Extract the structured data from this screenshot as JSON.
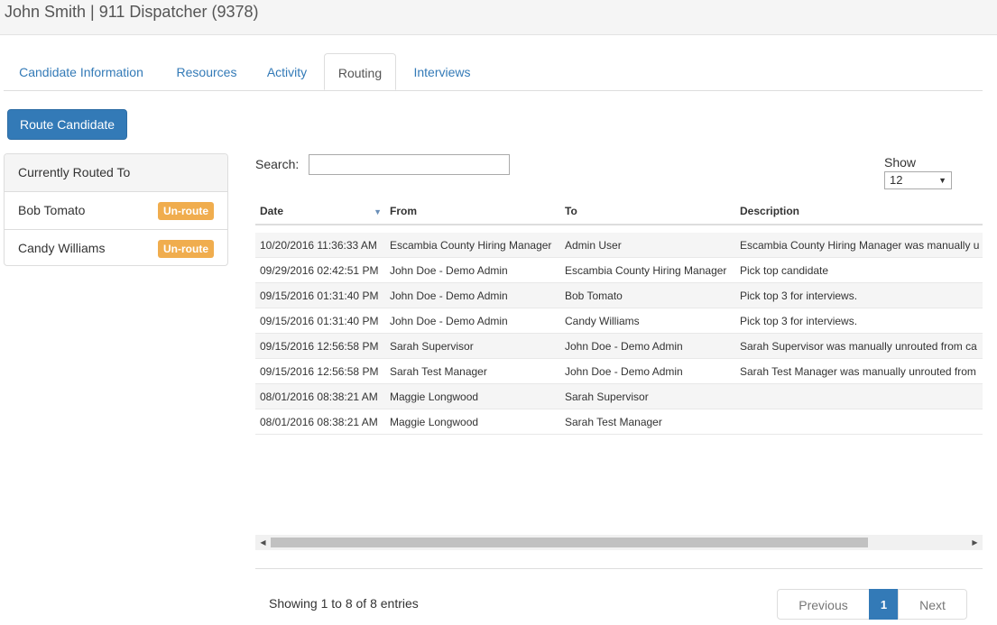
{
  "header": {
    "title": "John Smith | 911 Dispatcher (9378)"
  },
  "tabs": [
    {
      "label": "Candidate Information"
    },
    {
      "label": "Resources"
    },
    {
      "label": "Activity"
    },
    {
      "label": "Routing"
    },
    {
      "label": "Interviews"
    }
  ],
  "active_tab": "Routing",
  "route_button": "Route Candidate",
  "routed_panel": {
    "heading": "Currently Routed To",
    "items": [
      {
        "name": "Bob Tomato",
        "action": "Un-route"
      },
      {
        "name": "Candy Williams",
        "action": "Un-route"
      }
    ]
  },
  "search": {
    "label": "Search:",
    "value": ""
  },
  "show": {
    "label": "Show",
    "value": "12"
  },
  "table": {
    "columns": [
      "Date",
      "From",
      "To",
      "Description"
    ],
    "rows": [
      [
        "10/20/2016 11:36:33 AM",
        "Escambia County Hiring Manager",
        "Admin User",
        "Escambia County Hiring Manager was manually u"
      ],
      [
        "09/29/2016 02:42:51 PM",
        "John Doe - Demo Admin",
        "Escambia County Hiring Manager",
        "Pick top candidate"
      ],
      [
        "09/15/2016 01:31:40 PM",
        "John Doe - Demo Admin",
        "Bob Tomato",
        "Pick top 3 for interviews."
      ],
      [
        "09/15/2016 01:31:40 PM",
        "John Doe - Demo Admin",
        "Candy Williams",
        "Pick top 3 for interviews."
      ],
      [
        "09/15/2016 12:56:58 PM",
        "Sarah Supervisor",
        "John Doe - Demo Admin",
        "Sarah Supervisor was manually unrouted from ca"
      ],
      [
        "09/15/2016 12:56:58 PM",
        "Sarah Test Manager",
        "John Doe - Demo Admin",
        "Sarah Test Manager was manually unrouted from"
      ],
      [
        "08/01/2016 08:38:21 AM",
        "Maggie Longwood",
        "Sarah Supervisor",
        ""
      ],
      [
        "08/01/2016 08:38:21 AM",
        "Maggie Longwood",
        "Sarah Test Manager",
        ""
      ]
    ]
  },
  "footer": {
    "info": "Showing 1 to 8 of 8 entries",
    "prev": "Previous",
    "current_page": "1",
    "next": "Next"
  },
  "colors": {
    "primary": "#337ab7",
    "warning": "#f0ad4e"
  }
}
